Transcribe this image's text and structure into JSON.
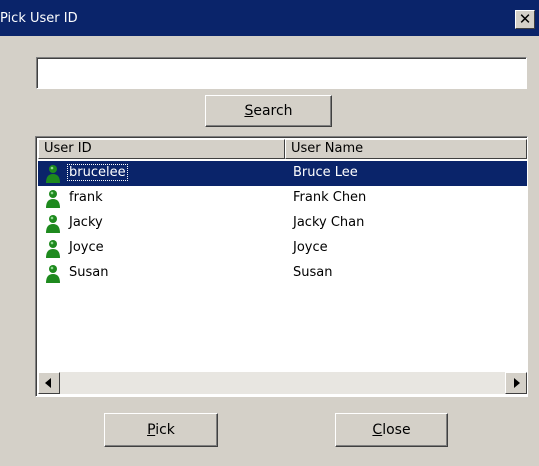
{
  "window": {
    "title": "Pick User ID",
    "close_glyph": "✕"
  },
  "search": {
    "value": "",
    "placeholder": "",
    "button_mnemonic": "S",
    "button_rest": "earch"
  },
  "table": {
    "columns": [
      {
        "label": "User ID"
      },
      {
        "label": "User Name"
      }
    ],
    "rows": [
      {
        "user_id": "brucelee",
        "user_name": "Bruce Lee",
        "selected": true,
        "icon": "user-icon"
      },
      {
        "user_id": "frank",
        "user_name": "Frank Chen",
        "selected": false,
        "icon": "user-icon"
      },
      {
        "user_id": "Jacky",
        "user_name": "Jacky Chan",
        "selected": false,
        "icon": "user-icon"
      },
      {
        "user_id": "Joyce",
        "user_name": "Joyce",
        "selected": false,
        "icon": "user-icon"
      },
      {
        "user_id": "Susan",
        "user_name": "Susan",
        "selected": false,
        "icon": "user-icon"
      }
    ]
  },
  "buttons": {
    "pick_mnemonic": "P",
    "pick_rest": "ick",
    "close_mnemonic": "C",
    "close_rest": "lose"
  },
  "colors": {
    "titlebar": "#0a246a",
    "selection": "#0a246a",
    "dialog_face": "#d4d0c8",
    "user_icon": "#1e8a1e"
  }
}
